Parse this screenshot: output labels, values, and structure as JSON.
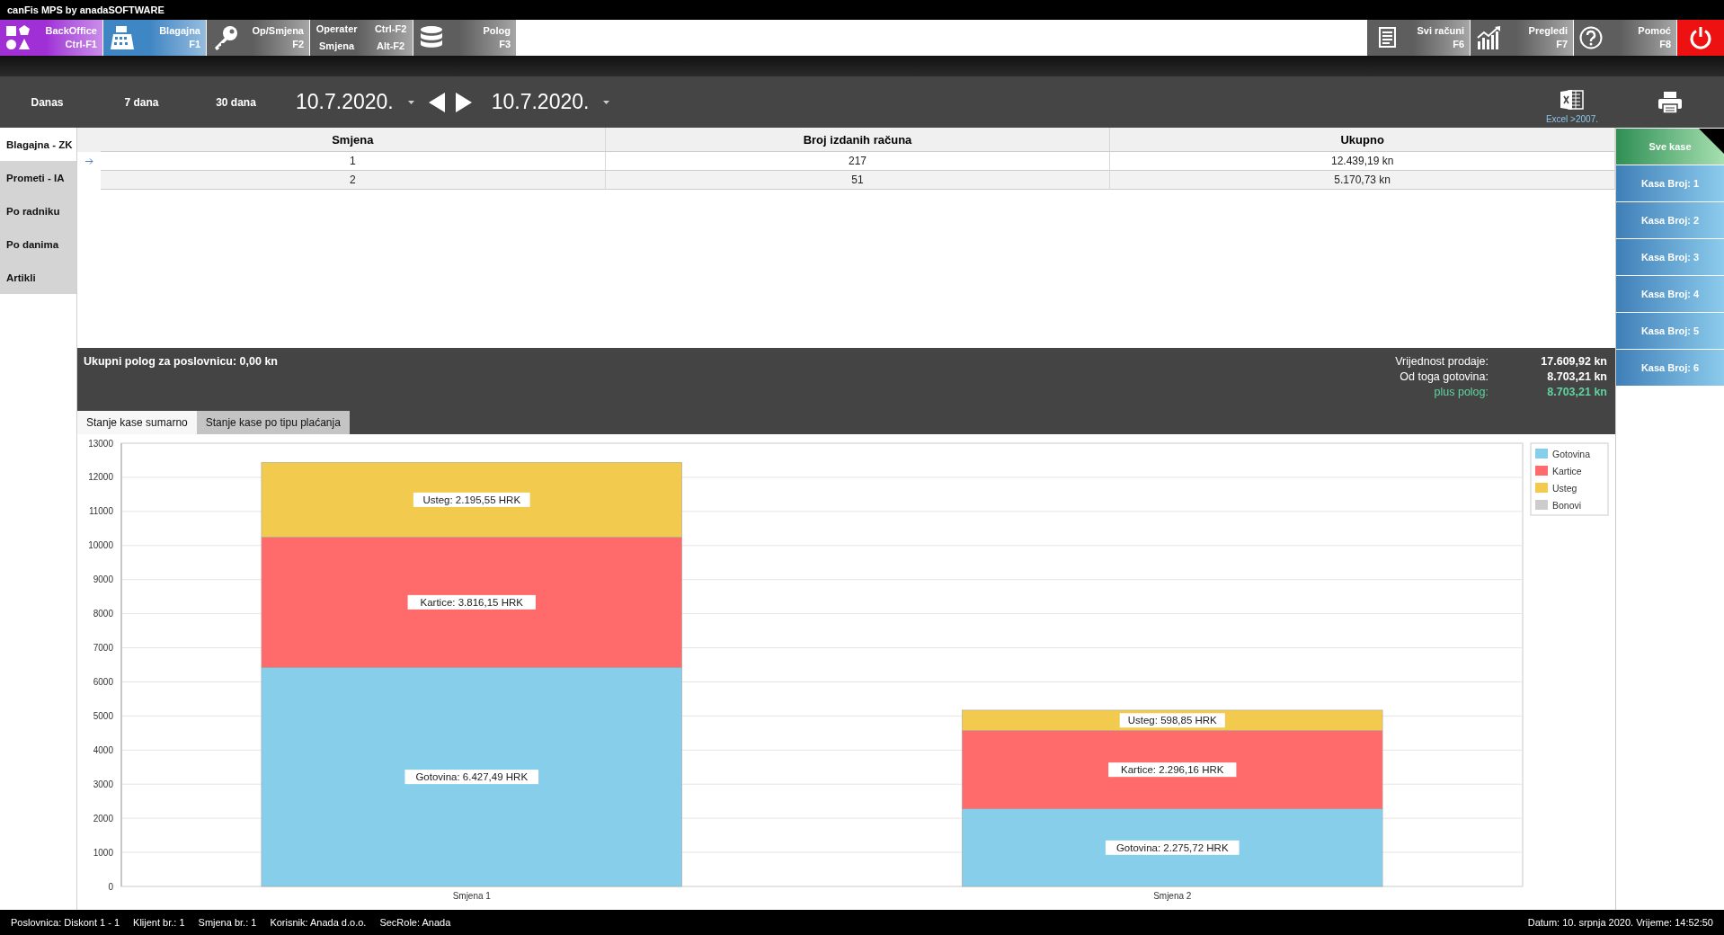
{
  "window": {
    "title": "canFis MPS by anadaSOFTWARE"
  },
  "nav_left": [
    {
      "kind": "button",
      "label": "BackOffice",
      "shortcut": "Ctrl-F1",
      "color": "#a02fd6"
    },
    {
      "kind": "button",
      "label": "Blagajna",
      "shortcut": "F1",
      "color": "#3f86c4"
    },
    {
      "kind": "button",
      "label": "Op/Smjena",
      "shortcut": "F2",
      "color": "#5e5e5e"
    },
    {
      "kind": "pair",
      "rows": [
        {
          "label": "Operater",
          "shortcut": "Ctrl-F2"
        },
        {
          "label": "Smjena",
          "shortcut": "Alt-F2"
        }
      ],
      "color": "#5e5e5e"
    },
    {
      "kind": "button",
      "label": "Polog",
      "shortcut": "F3",
      "color": "#5e5e5e"
    }
  ],
  "nav_right": [
    {
      "kind": "button",
      "label": "Svi računi",
      "shortcut": "F6",
      "color": "#5e5e5e"
    },
    {
      "kind": "button",
      "label": "Pregledi",
      "shortcut": "F7",
      "color": "#5e5e5e"
    },
    {
      "kind": "button",
      "label": "Pomoć",
      "shortcut": "F8",
      "color": "#5e5e5e"
    },
    {
      "kind": "power",
      "color": "#ee1111"
    }
  ],
  "toolbar": {
    "ranges": [
      "Danas",
      "7 dana",
      "30 dana"
    ],
    "date_from": "10.7.2020.",
    "date_to": "10.7.2020.",
    "export_label": "Excel >2007."
  },
  "sidebar": {
    "items": [
      {
        "label": "Blagajna - ZK",
        "selected": true
      },
      {
        "label": "Prometi - IA",
        "selected": false
      },
      {
        "label": "Po radniku",
        "selected": false
      },
      {
        "label": "Po danima",
        "selected": false
      },
      {
        "label": "Artikli",
        "selected": false
      }
    ]
  },
  "table": {
    "columns": [
      "Smjena",
      "Broj izdanih računa",
      "Ukupno"
    ],
    "rows": [
      {
        "selected": true,
        "cells": [
          "1",
          "217",
          "12.439,19 kn"
        ]
      },
      {
        "selected": false,
        "cells": [
          "2",
          "51",
          "5.170,73 kn"
        ]
      }
    ]
  },
  "summary": {
    "deposit": "Ukupni polog za poslovnicu: 0,00 kn",
    "lines": [
      {
        "kind": "normal",
        "label": "Vrijednost prodaje:",
        "value": "17.609,92 kn"
      },
      {
        "kind": "normal",
        "label": "Od toga gotovina:",
        "value": "8.703,21 kn"
      },
      {
        "kind": "accent",
        "label": "plus polog:",
        "value": "8.703,21 kn"
      }
    ]
  },
  "tabs": [
    {
      "label": "Stanje kase sumarno",
      "selected": true
    },
    {
      "label": "Stanje kase po tipu plaćanja",
      "selected": false
    }
  ],
  "chart": {
    "chart_data": {
      "type": "bar",
      "stacked": true,
      "categories": [
        "Smjena 1",
        "Smjena 2"
      ],
      "series": [
        {
          "name": "Gotovina",
          "color": "#87ceeb",
          "values": [
            6427.49,
            2275.72
          ]
        },
        {
          "name": "Kartice",
          "color": "#ff6b6b",
          "values": [
            3816.15,
            2296.16
          ]
        },
        {
          "name": "Usteg",
          "color": "#f2cb4e",
          "values": [
            2195.55,
            598.85
          ]
        },
        {
          "name": "Bonovi",
          "color": "#cccccc",
          "values": [
            0,
            0
          ]
        }
      ],
      "grid": true,
      "legend": true,
      "ylim": [
        0,
        13000
      ],
      "yticks": [
        0,
        1000,
        2000,
        3000,
        4000,
        5000,
        6000,
        7000,
        8000,
        9000,
        10000,
        11000,
        12000,
        13000
      ],
      "value_labels": [
        [
          "Gotovina: 6.427,49 HRK",
          "Gotovina: 2.275,72 HRK"
        ],
        [
          "Kartice: 3.816,15 HRK",
          "Kartice: 2.296,16 HRK"
        ],
        [
          "Usteg: 2.195,55 HRK",
          "Usteg: 598,85 HRK"
        ],
        null
      ]
    }
  },
  "registers": [
    {
      "label": "Sve kase",
      "selected": true
    },
    {
      "label": "Kasa Broj: 1",
      "selected": false
    },
    {
      "label": "Kasa Broj: 2",
      "selected": false
    },
    {
      "label": "Kasa Broj: 3",
      "selected": false
    },
    {
      "label": "Kasa Broj: 4",
      "selected": false
    },
    {
      "label": "Kasa Broj: 5",
      "selected": false
    },
    {
      "label": "Kasa Broj: 6",
      "selected": false
    }
  ],
  "status_bar": {
    "items": [
      "Poslovnica: Diskont 1 - 1",
      "Klijent br.: 1",
      "Smjena br.: 1",
      "Korisnik: Anada d.o.o.",
      "SecRole: Anada"
    ],
    "right": "Datum: 10. srpnja 2020. Vrijeme: 14:52:50"
  }
}
